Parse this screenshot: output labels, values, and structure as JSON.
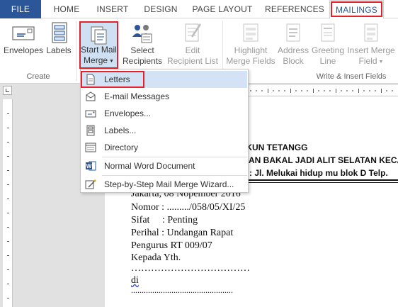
{
  "tabs": {
    "file": "FILE",
    "home": "HOME",
    "insert": "INSERT",
    "design": "DESIGN",
    "page_layout": "PAGE LAYOUT",
    "references": "REFERENCES",
    "mailings": "MAILINGS"
  },
  "ribbon": {
    "envelopes": "Envelopes",
    "labels": "Labels",
    "create_group": "Create",
    "start_mail_merge_1": "Start Mail",
    "start_mail_merge_2": "Merge",
    "select_recipients_1": "Select",
    "select_recipients_2": "Recipients",
    "edit_recipient_list_1": "Edit",
    "edit_recipient_list_2": "Recipient List",
    "highlight_merge_fields_1": "Highlight",
    "highlight_merge_fields_2": "Merge Fields",
    "address_block_1": "Address",
    "address_block_2": "Block",
    "greeting_line_1": "Greeting",
    "greeting_line_2": "Line",
    "insert_merge_field_1": "Insert Merge",
    "insert_merge_field_2": "Field",
    "write_insert_group": "Write & Insert Fields",
    "accent": "#2b579a",
    "highlight_red": "#e0232a"
  },
  "menu": {
    "items": [
      {
        "label": "Letters",
        "icon": "letter-icon"
      },
      {
        "label": "E-mail Messages",
        "icon": "email-icon"
      },
      {
        "label": "Envelopes...",
        "icon": "envelope-icon"
      },
      {
        "label": "Labels...",
        "icon": "labels-icon"
      },
      {
        "label": "Directory",
        "icon": "directory-icon"
      },
      {
        "label": "Normal Word Document",
        "icon": "word-document-icon"
      },
      {
        "label": "Step-by-Step Mail Merge Wizard...",
        "icon": "wizard-icon"
      }
    ]
  },
  "document": {
    "heading_1": "RUKUN TETANGG",
    "heading_2": "AN BAKAL JADI ALIT SELATAN KECA",
    "heading_3": ": Jl. Melukai hidup mu blok D Telp.",
    "lines": [
      "Jakarta, 08 Nopember 2016",
      "Nomor : ........./058/05/XI/25",
      "Sifat     : Penting",
      "Perihal : Undangan Rapat",
      "Pengurus RT 009/07",
      "Kepada Yth.",
      "………………………………",
      "di",
      "................................................"
    ]
  }
}
